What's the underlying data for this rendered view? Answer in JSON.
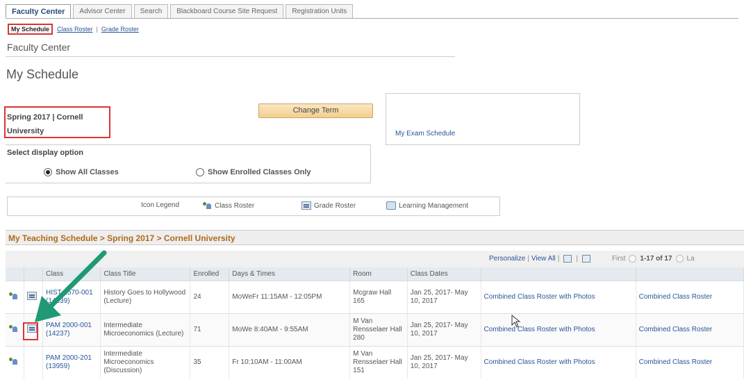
{
  "tabs": [
    {
      "label": "Faculty Center"
    },
    {
      "label": "Advisor Center"
    },
    {
      "label": "Search"
    },
    {
      "label": "Blackboard Course Site Request"
    },
    {
      "label": "Registration Units"
    }
  ],
  "subnav": {
    "current": "My Schedule",
    "class_roster": "Class Roster",
    "grade_roster": "Grade Roster",
    "sep": "|"
  },
  "section_title": "Faculty Center",
  "page_title": "My Schedule",
  "term": {
    "label": "Spring 2017 | Cornell University",
    "change_button": "Change Term"
  },
  "exam_link": "My Exam Schedule",
  "display_options": {
    "label": "Select display option",
    "show_all": "Show All Classes",
    "show_enrolled": "Show Enrolled Classes Only",
    "selected": "show_all"
  },
  "legend": {
    "label": "Icon Legend",
    "class_roster": "Class Roster",
    "grade_roster": "Grade Roster",
    "learning_mgmt": "Learning Management"
  },
  "schedule_header": "My Teaching Schedule > Spring 2017 > Cornell University",
  "toolbar": {
    "personalize": "Personalize",
    "view_all": "View All",
    "first": "First",
    "count": "1-17 of 17",
    "last": "La",
    "sep": "|"
  },
  "table": {
    "headers": [
      "",
      "",
      "Class",
      "Class Title",
      "Enrolled",
      "Days & Times",
      "Room",
      "Class Dates",
      "",
      ""
    ],
    "rows": [
      {
        "class": "HIST 1570-001 (14239)",
        "title": "History Goes to Hollywood (Lecture)",
        "enrolled": "24",
        "days": "MoWeFr 11:15AM - 12:05PM",
        "room": "Mcgraw Hall 165",
        "dates": "Jan 25, 2017- May 10, 2017",
        "link1": "Combined Class Roster with Photos",
        "link2": "Combined Class Roster"
      },
      {
        "class": "PAM 2000-001 (14237)",
        "title": "Intermediate Microeconomics (Lecture)",
        "enrolled": "71",
        "days": "MoWe 8:40AM - 9:55AM",
        "room": "M Van Rensselaer Hall 280",
        "dates": "Jan 25, 2017- May 10, 2017",
        "link1": "Combined Class Roster with Photos",
        "link2": "Combined Class Roster"
      },
      {
        "class": "PAM 2000-201 (13959)",
        "title": "Intermediate Microeconomics (Discussion)",
        "enrolled": "35",
        "days": "Fr 10:10AM - 11:00AM",
        "room": "M Van Rensselaer Hall 151",
        "dates": "Jan 25, 2017- May 10, 2017",
        "link1": "Combined Class Roster with Photos",
        "link2": "Combined Class Roster"
      }
    ]
  },
  "colors": {
    "highlight": "#d33333",
    "arrow": "#1f9a74",
    "link": "#2a5599",
    "section_header": "#b06a1a"
  }
}
